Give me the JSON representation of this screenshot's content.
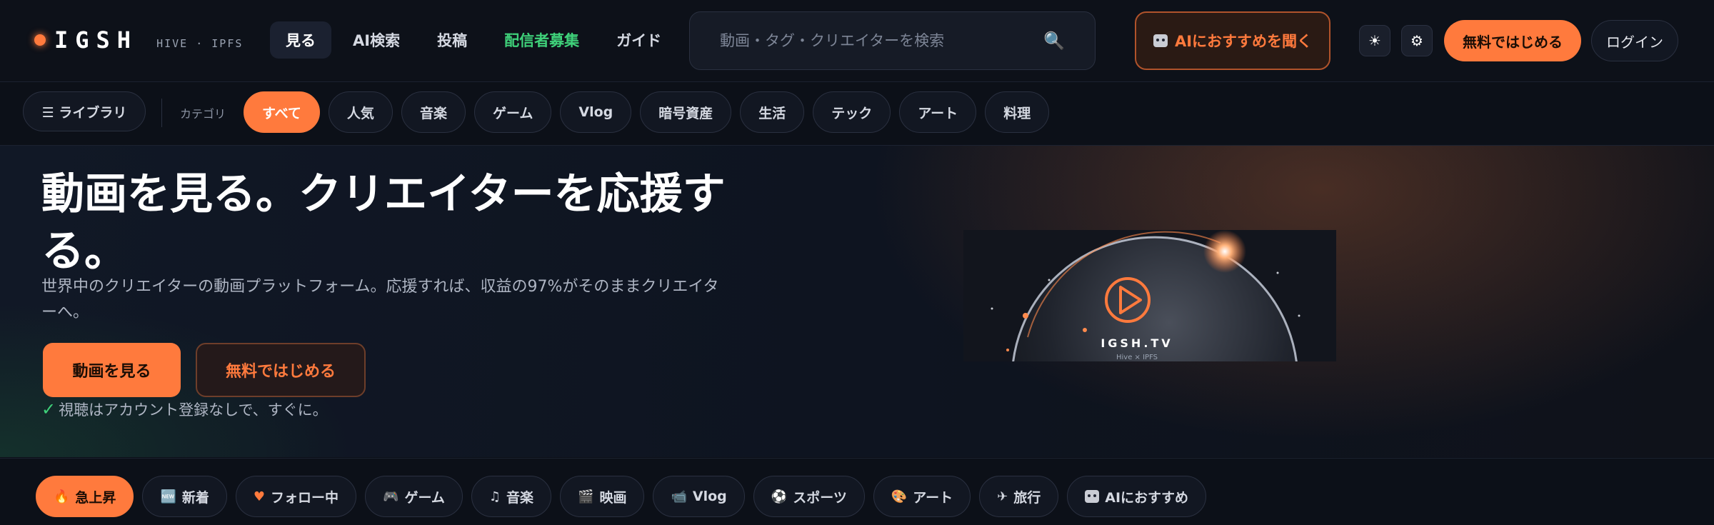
{
  "brand": {
    "name": "IGSH",
    "sub": "HIVE · IPFS"
  },
  "nav": {
    "items": [
      "見る",
      "AI検索",
      "投稿",
      "配信者募集",
      "ガイド"
    ]
  },
  "search": {
    "placeholder": "動画・タグ・クリエイターを検索",
    "icon": "search-icon"
  },
  "header": {
    "ai_button": "AIにおすすめを聞く",
    "theme_icon": "sun-icon",
    "settings_icon": "gear-icon",
    "start_button": "無料ではじめる",
    "login_button": "ログイン"
  },
  "categories": {
    "library_label": "☰ ライブラリ",
    "label": "カテゴリ",
    "items": [
      "すべて",
      "人気",
      "音楽",
      "ゲーム",
      "Vlog",
      "暗号資産",
      "生活",
      "テック",
      "アート",
      "料理"
    ]
  },
  "hero": {
    "title": "動画を見る。クリエイターを応援する。",
    "subtitle": "世界中のクリエイターの動画プラットフォーム。応援すれば、収益の97%がそのままクリエイターへ。",
    "watch_button": "動画を見る",
    "free_button": "無料ではじめる",
    "note": "視聴はアカウント登録なしで、すぐに。",
    "art_brand": "IGSH.TV",
    "art_sub": "Hive × IPFS"
  },
  "chips": [
    {
      "label": "急上昇",
      "icon": "fire-icon"
    },
    {
      "label": "新着",
      "icon": "new-icon"
    },
    {
      "label": "フォロー中",
      "icon": "heart-icon"
    },
    {
      "label": "ゲーム",
      "icon": "gamepad-icon"
    },
    {
      "label": "音楽",
      "icon": "music-note-icon"
    },
    {
      "label": "映画",
      "icon": "clapper-icon"
    },
    {
      "label": "Vlog",
      "icon": "camera-icon"
    },
    {
      "label": "スポーツ",
      "icon": "soccer-ball-icon"
    },
    {
      "label": "アート",
      "icon": "palette-icon"
    },
    {
      "label": "旅行",
      "icon": "airplane-icon"
    },
    {
      "label": "AIにおすすめ",
      "icon": "robot-icon"
    }
  ],
  "colors": {
    "accent": "#ff7a3d",
    "green": "#3fd17a",
    "background": "#0b0f17"
  }
}
